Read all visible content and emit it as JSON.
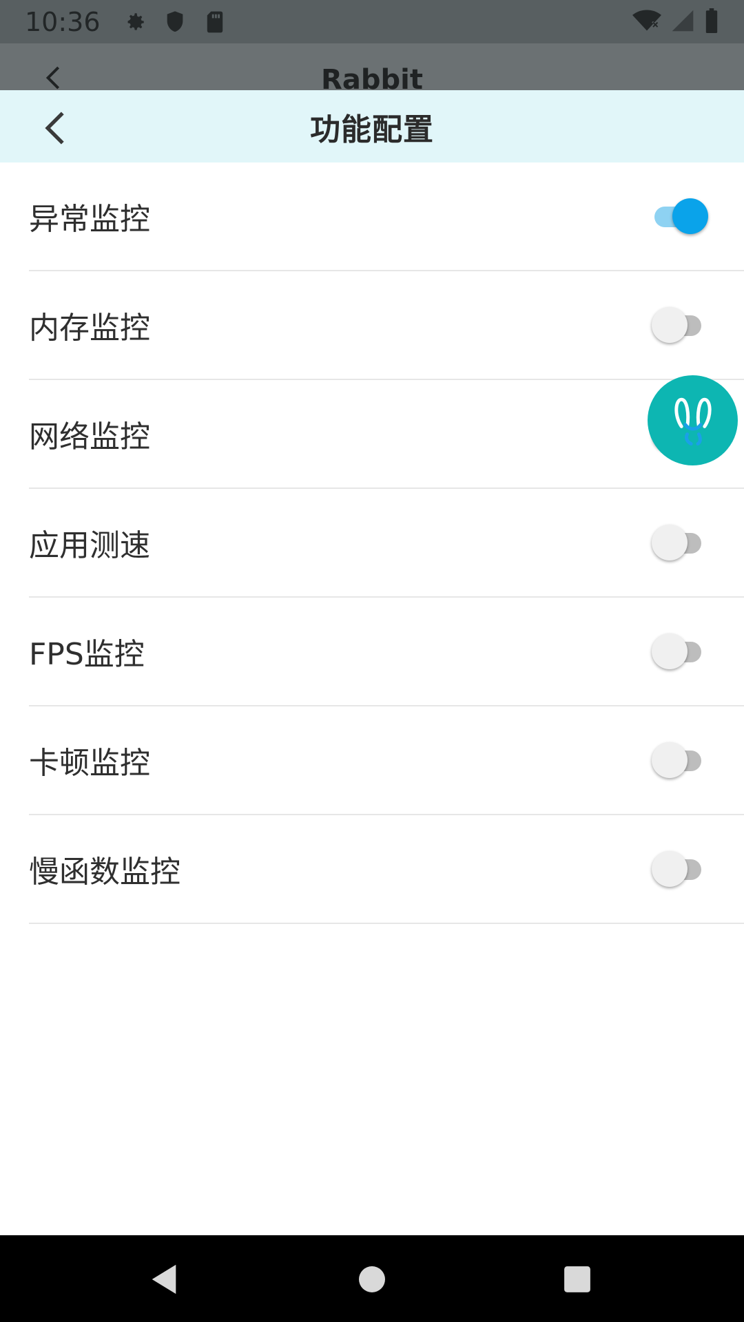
{
  "status_bar": {
    "time": "10:36",
    "left_icons": [
      "gear-icon",
      "shield-icon",
      "sd-card-icon"
    ],
    "right_icons": [
      "wifi-off-icon",
      "signal-icon",
      "battery-icon"
    ]
  },
  "background_toolbar": {
    "title": "Rabbit"
  },
  "sheet": {
    "title": "功能配置",
    "settings": [
      {
        "label": "异常监控",
        "enabled": true
      },
      {
        "label": "内存监控",
        "enabled": false
      },
      {
        "label": "网络监控",
        "enabled": false
      },
      {
        "label": "应用测速",
        "enabled": false
      },
      {
        "label": "FPS监控",
        "enabled": false
      },
      {
        "label": "卡顿监控",
        "enabled": false
      },
      {
        "label": "慢函数监控",
        "enabled": false
      }
    ]
  },
  "floating_button": {
    "icon": "rabbit-icon",
    "color": "#0db6b2"
  },
  "colors": {
    "header_bg": "#e1f6f9",
    "toggle_on": "#0aa3ea",
    "toggle_on_track": "#8ed2f2"
  }
}
